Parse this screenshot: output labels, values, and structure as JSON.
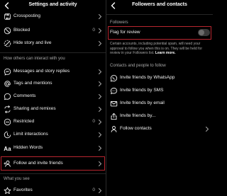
{
  "left": {
    "title": "Settings and activity",
    "rows_top": [
      {
        "label": "Crossposting"
      },
      {
        "label": "Blocked",
        "count": "0"
      },
      {
        "label": "Hide story and live"
      }
    ],
    "section_interact": "How others can interact with you",
    "rows_interact": [
      {
        "label": "Messages and story replies"
      },
      {
        "label": "Tags and mentions"
      },
      {
        "label": "Comments"
      },
      {
        "label": "Sharing and remixes"
      },
      {
        "label": "Restricted",
        "count": "0"
      },
      {
        "label": "Limit interactions"
      },
      {
        "label": "Hidden Words"
      },
      {
        "label": "Follow and invite friends"
      }
    ],
    "section_see": "What you see",
    "rows_see": [
      {
        "label": "Favorites",
        "count": "0"
      }
    ]
  },
  "right": {
    "title": "Followers and contacts",
    "section_followers": "Followers",
    "flag_label": "Flag for review",
    "flag_on": false,
    "description": "Certain accounts, including potential spam, will need your approval to follow you when this is on. They will be held for review in your Followers list.",
    "learn_more": "Learn more.",
    "section_contacts": "Contacts and people to follow",
    "rows": [
      {
        "label": "Invite friends by WhatsApp"
      },
      {
        "label": "Invite friends by SMS"
      },
      {
        "label": "Invite friends by email"
      },
      {
        "label": "Invite friends by..."
      },
      {
        "label": "Follow contacts"
      }
    ]
  },
  "colors": {
    "background": "#000000",
    "text": "#f2f2f2",
    "muted": "#a8a8a8",
    "highlight": "#b8262f"
  }
}
